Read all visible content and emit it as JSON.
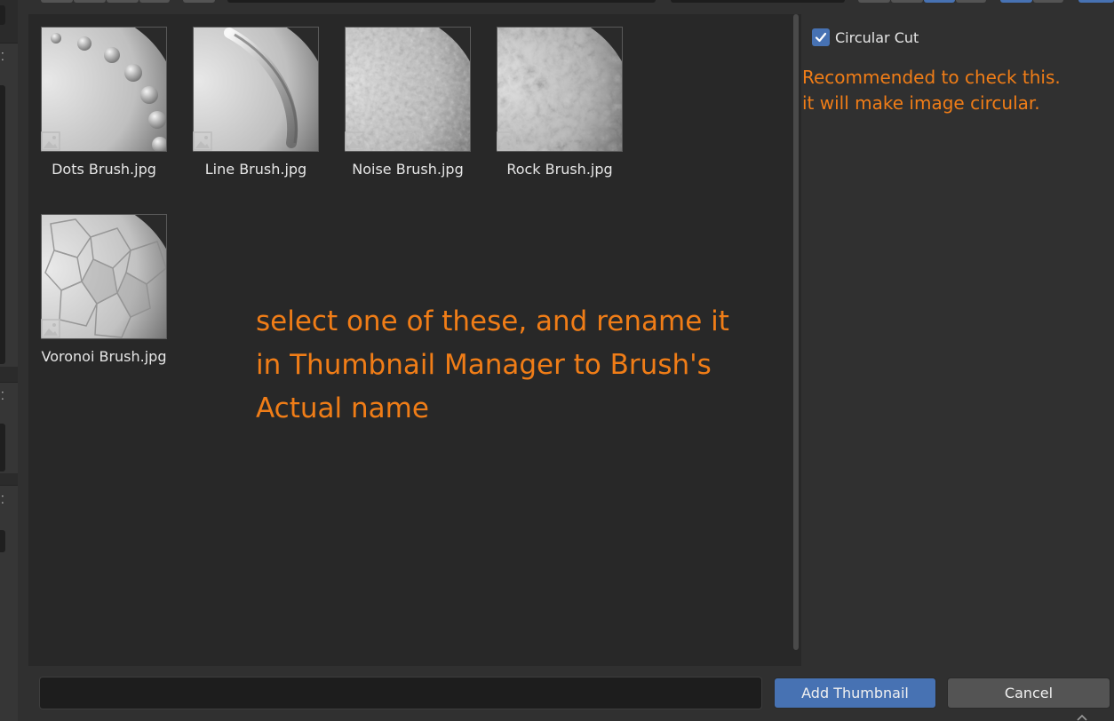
{
  "thumbnails": [
    {
      "label": "Dots Brush.jpg",
      "pattern": "dots"
    },
    {
      "label": "Line Brush.jpg",
      "pattern": "line"
    },
    {
      "label": "Noise Brush.jpg",
      "pattern": "noise"
    },
    {
      "label": "Rock Brush.jpg",
      "pattern": "rock"
    },
    {
      "label": "Voronoi Brush.jpg",
      "pattern": "voronoi"
    }
  ],
  "options": {
    "circular_cut_label": "Circular Cut",
    "circular_cut_checked": true
  },
  "annotations": {
    "main_line1": "select one of these, and rename it",
    "main_line2": "in Thumbnail Manager to Brush's",
    "main_line3": "Actual name",
    "options_line1": "Recommended to check this.",
    "options_line2": "it will make image circular."
  },
  "footer": {
    "filename_value": "",
    "add_label": "Add Thumbnail",
    "cancel_label": "Cancel"
  },
  "colors": {
    "accent": "#4772b3",
    "annotation": "#f07d17"
  }
}
